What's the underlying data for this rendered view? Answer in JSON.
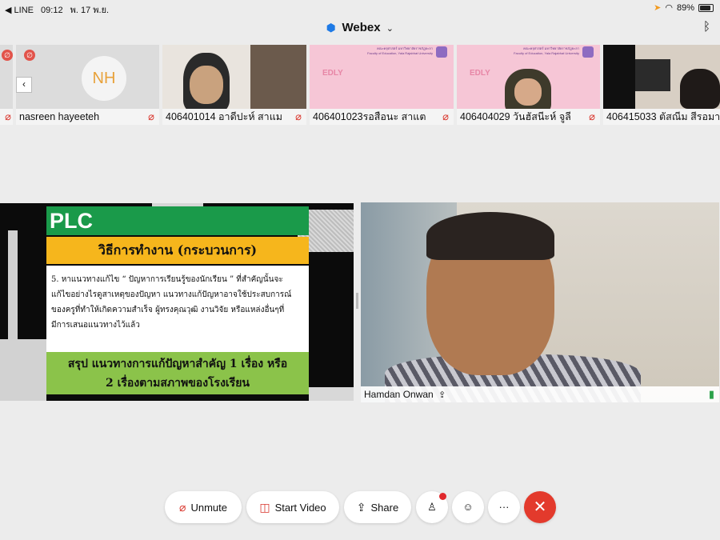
{
  "status_bar": {
    "back_app": "◀ LINE",
    "time": "09:12",
    "date": "พ. 17 พ.ย.",
    "battery": "89%"
  },
  "app": {
    "title": "Webex"
  },
  "participants": [
    {
      "name": "nasreen hayeeteh",
      "initials": "NH",
      "muted": true
    },
    {
      "name": "406401014 อาดีปะห์ สาแม",
      "muted": true
    },
    {
      "name": "406401023รอสือนะ สาแต",
      "muted": true
    },
    {
      "name": "406404029 วันฮัสนีะห์ จูลี",
      "muted": true
    },
    {
      "name": "406415033 ตัสณีม สีรอมา",
      "muted": false
    }
  ],
  "pink_header": {
    "line1": "คณะครุศาสตร์ มหาวิทยาลัยราชภัฏยะลา",
    "line2": "Faculty of Education, Yala Rajabhat University",
    "mark": "EDLY"
  },
  "slide": {
    "title": "PLC",
    "subtitle": "วิธีการทำงาน (กระบวนการ)",
    "body_lines": [
      "5. หาแนวทางแก้ไข “ ปัญหาการเรียนรู้ของนักเรียน ” ที่สำคัญนั้นจะ",
      "แก้ไขอย่างไรดูสาเหตุของปัญหา  แนวทางแก้ปัญหาอาจใช้ประสบการณ์",
      "ของครูที่ทำให้เกิดความสำเร็จ  ผู้ทรงคุณวุฒิ  งานวิจัย หรือแหล่งอื่นๆที่",
      "มีการเสนอแนวทางไว้แล้ว"
    ],
    "summary_lines": [
      "สรุป  แนวทางการแก้ปัญหาสำคัญ  1 เรื่อง  หรือ",
      "2 เรื่องตามสภาพของโรงเรียน"
    ]
  },
  "active_speaker": {
    "name": "Hamdan Onwan"
  },
  "controls": {
    "unmute": "Unmute",
    "start_video": "Start Video",
    "share": "Share",
    "more": "···"
  },
  "colors": {
    "mute_red": "#d9342b",
    "end_red": "#e33a2c",
    "plc_green": "#1a9a4a",
    "slide_orange": "#f6b61c",
    "summary_green": "#8bc34a",
    "webex_blue": "#1e7ae6"
  }
}
